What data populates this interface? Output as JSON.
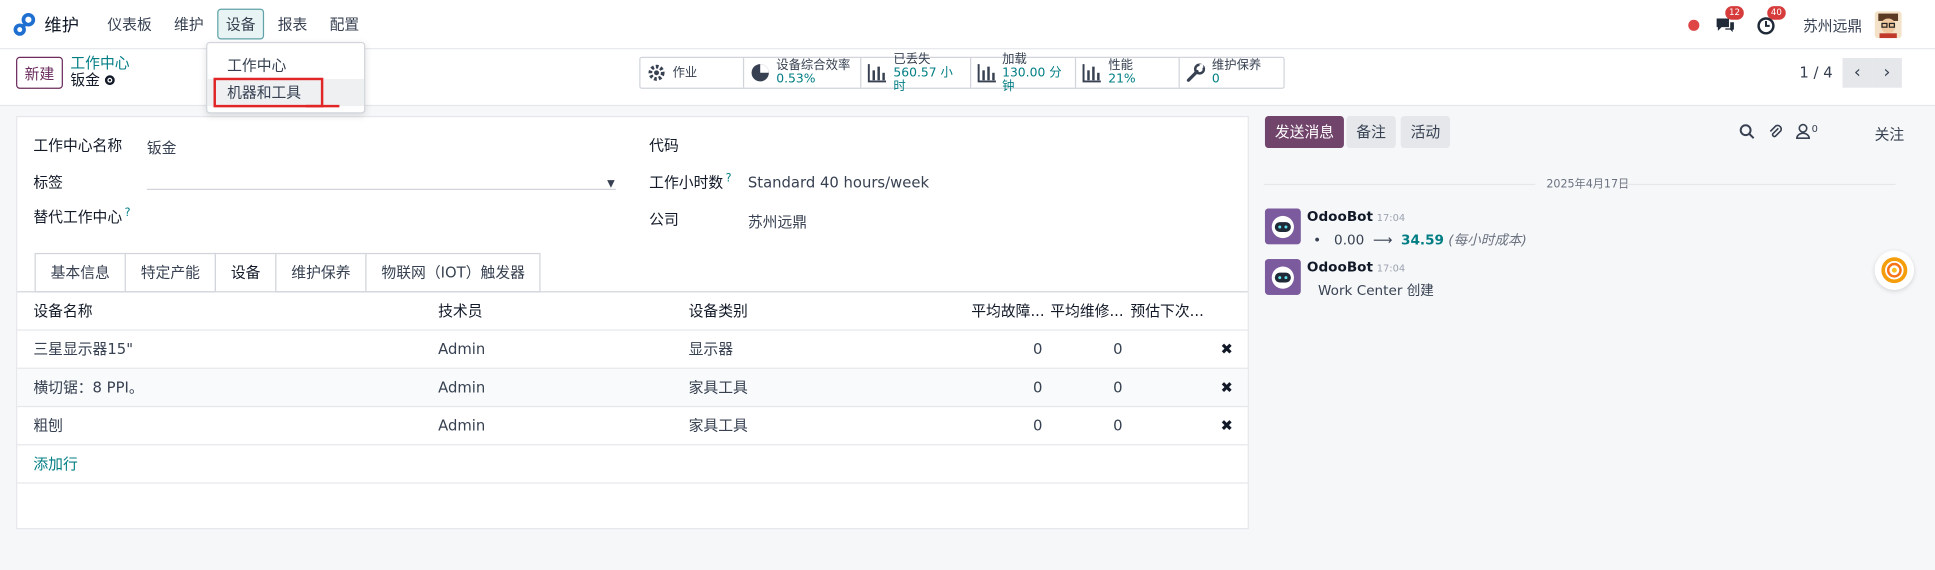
{
  "app": {
    "name": "维护"
  },
  "menu": [
    "仪表板",
    "维护",
    "设备",
    "报表",
    "配置"
  ],
  "notifications": {
    "messages_count": "12",
    "activities_count": "40"
  },
  "user": {
    "company": "苏州远鼎"
  },
  "dropdown": {
    "items": [
      "工作中心",
      "机器和工具"
    ]
  },
  "control": {
    "new_label": "新建",
    "breadcrumb_parent": "工作中心",
    "breadcrumb_current": "钣金",
    "pager": "1 / 4"
  },
  "stats": [
    {
      "label": "作业",
      "value": "",
      "icon": "gear-icon"
    },
    {
      "label": "设备综合效率",
      "value": "0.53%",
      "icon": "pie-chart-icon"
    },
    {
      "label": "已丢失",
      "value": "560.57 小时",
      "icon": "bar-chart-icon"
    },
    {
      "label": "加载",
      "value": "130.00 分钟",
      "icon": "bar-chart-icon"
    },
    {
      "label": "性能",
      "value": "21%",
      "icon": "bar-chart-icon"
    },
    {
      "label": "维护保养",
      "value": "0",
      "icon": "wrench-icon"
    }
  ],
  "form": {
    "name_label": "工作中心名称",
    "name_value": "钣金",
    "tag_label": "标签",
    "alt_label": "替代工作中心",
    "help_mark": "?",
    "code_label": "代码",
    "hours_label": "工作小时数",
    "hours_value": "Standard 40 hours/week",
    "company_label": "公司",
    "company_value": "苏州远鼎"
  },
  "tabs": [
    "基本信息",
    "特定产能",
    "设备",
    "维护保养",
    "物联网（IOT）触发器"
  ],
  "table": {
    "headers": [
      "设备名称",
      "技术员",
      "设备类别",
      "平均故障...",
      "平均维修...",
      "预估下次..."
    ],
    "rows": [
      [
        "三星显示器15\"",
        "Admin",
        "显示器",
        "0",
        "0"
      ],
      [
        "横切锯：8 PPI。",
        "Admin",
        "家具工具",
        "0",
        "0"
      ],
      [
        "粗刨",
        "Admin",
        "家具工具",
        "0",
        "0"
      ]
    ],
    "add_line": "添加行"
  },
  "chatter": {
    "send_label": "发送消息",
    "note_label": "备注",
    "activity_label": "活动",
    "followers_count": "0",
    "follow_label": "关注",
    "date": "2025年4月17日",
    "messages": [
      {
        "author": "OdooBot",
        "time": "17:04",
        "old": "0.00",
        "new": "34.59",
        "field": "(每小时成本)"
      },
      {
        "author": "OdooBot",
        "time": "17:04",
        "text": "Work Center 创建"
      }
    ]
  },
  "colors": {
    "accent": "#017e84",
    "brand": "#71456b",
    "badge": "#d63c3c"
  }
}
